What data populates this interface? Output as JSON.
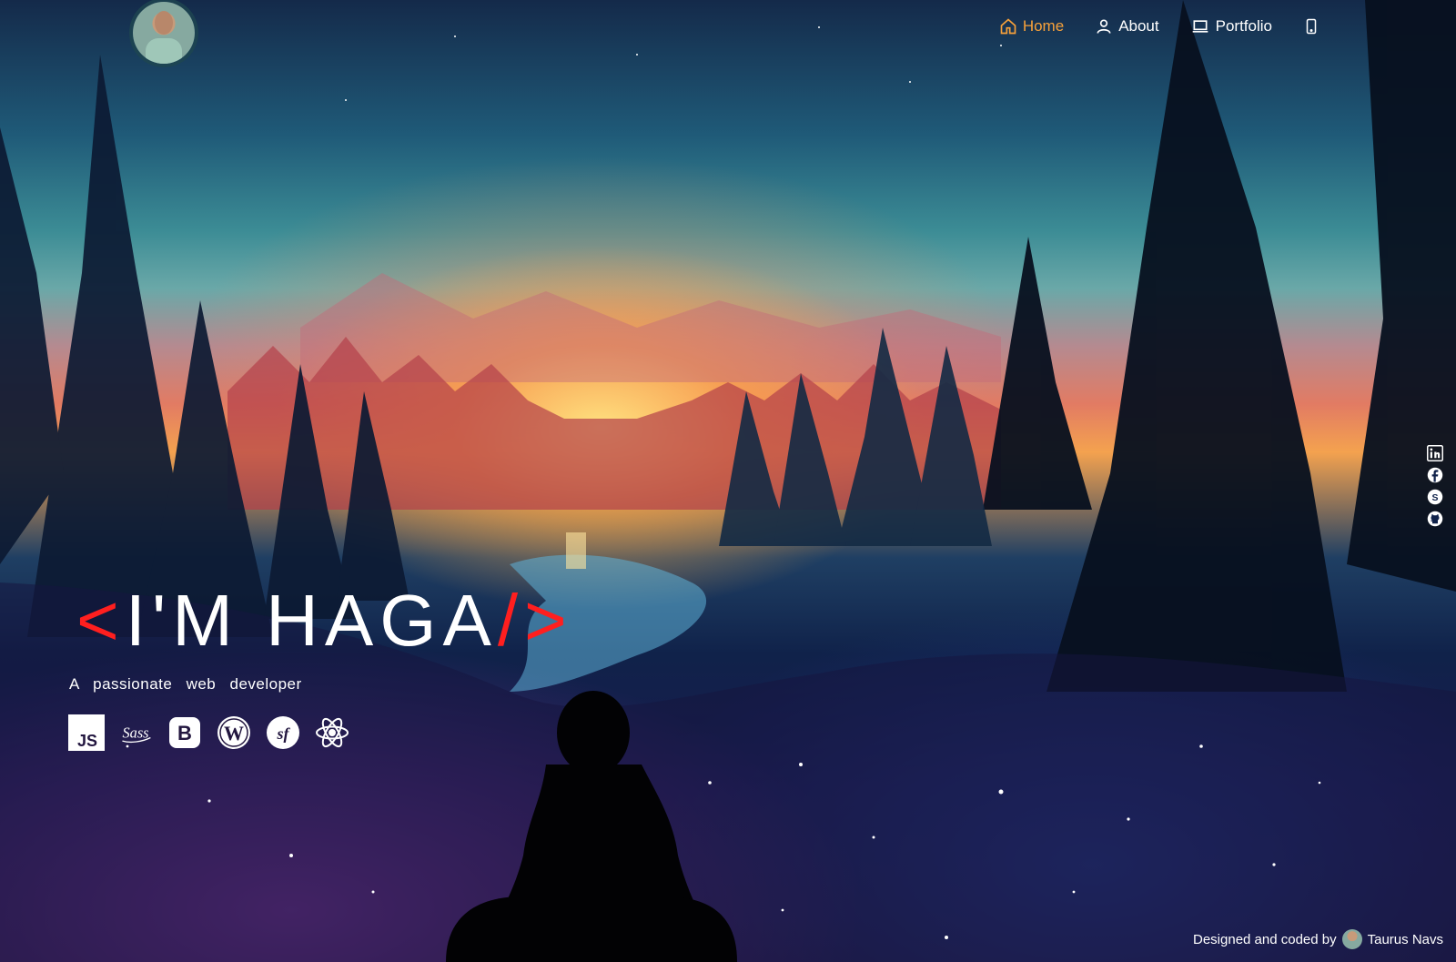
{
  "nav": {
    "items": [
      {
        "label": "Home",
        "icon": "home-icon",
        "active": true
      },
      {
        "label": "About",
        "icon": "user-icon",
        "active": false
      },
      {
        "label": "Portfolio",
        "icon": "laptop-icon",
        "active": false
      },
      {
        "label": "",
        "icon": "phone-icon",
        "active": false
      }
    ],
    "active_color": "#f7a13a"
  },
  "hero": {
    "open_bracket": "<",
    "name": "I'M HAGA",
    "close_slash": "/",
    "close_bracket": ">",
    "tagline": "A passionate web developer",
    "accent_color": "#ff1f1f"
  },
  "tech_stack": [
    {
      "icon": "javascript-icon",
      "label": "JS"
    },
    {
      "icon": "sass-icon",
      "label": "Sass"
    },
    {
      "icon": "bootstrap-icon",
      "label": "B"
    },
    {
      "icon": "wordpress-icon",
      "label": ""
    },
    {
      "icon": "symfony-icon",
      "label": "sf"
    },
    {
      "icon": "react-icon",
      "label": ""
    }
  ],
  "social": [
    "linkedin-icon",
    "facebook-icon",
    "skype-icon",
    "github-icon"
  ],
  "footer": {
    "credit_text": "Designed and coded by",
    "author": "Taurus Navs"
  }
}
